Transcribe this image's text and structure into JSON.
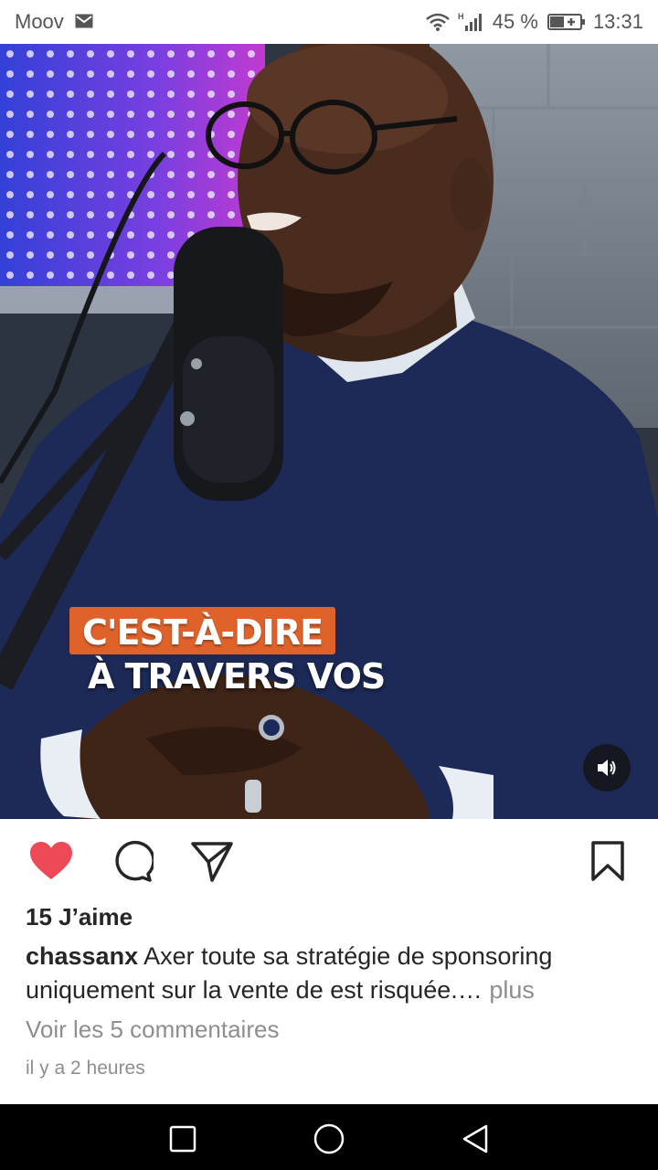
{
  "status_bar": {
    "carrier": "Moov",
    "battery": "45 %",
    "time": "13:31",
    "icons": [
      "mail-icon",
      "wifi-icon",
      "signal-icon",
      "battery-icon"
    ]
  },
  "video": {
    "caption_line1": "C'EST-À-DIRE",
    "caption_line2": "À TRAVERS VOS",
    "caption_accent": "#e0622b"
  },
  "actions": {
    "liked": true,
    "like_color": "#ed4956",
    "icons": [
      "heart-icon",
      "comment-icon",
      "share-icon",
      "bookmark-icon"
    ]
  },
  "post": {
    "likes": "15 J’aime",
    "username": "chassanx",
    "caption": "Axer toute sa stratégie de sponsoring uniquement sur la vente de est risquée.…",
    "more": "plus",
    "view_comments": "Voir les 5 commentaires",
    "timestamp": "il y a 2 heures"
  },
  "nav_bar": {
    "icons": [
      "recents-icon",
      "home-icon",
      "back-icon"
    ]
  }
}
